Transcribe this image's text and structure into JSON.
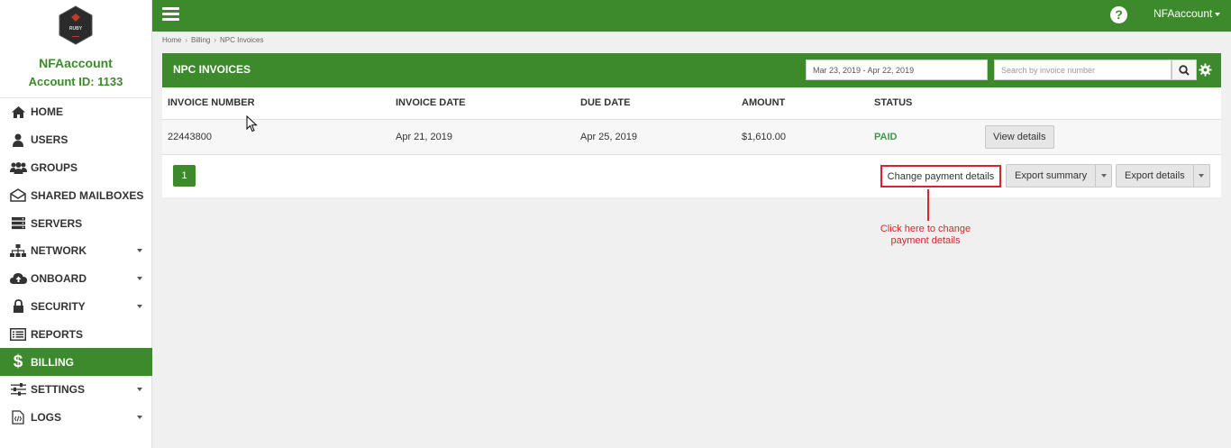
{
  "sidebar": {
    "logo_text": "RUBY",
    "account_name": "NFAaccount",
    "account_id": "Account ID: 1133",
    "items": [
      {
        "label": "HOME",
        "icon": "home-icon"
      },
      {
        "label": "USERS",
        "icon": "user-icon"
      },
      {
        "label": "GROUPS",
        "icon": "users-icon"
      },
      {
        "label": "SHARED MAILBOXES",
        "icon": "envelope-icon"
      },
      {
        "label": "SERVERS",
        "icon": "server-icon"
      },
      {
        "label": "NETWORK",
        "icon": "sitemap-icon"
      },
      {
        "label": "ONBOARD",
        "icon": "cloud-upload-icon"
      },
      {
        "label": "SECURITY",
        "icon": "lock-icon"
      },
      {
        "label": "REPORTS",
        "icon": "list-icon"
      },
      {
        "label": "BILLING",
        "icon": "dollar-icon"
      },
      {
        "label": "SETTINGS",
        "icon": "sliders-icon"
      },
      {
        "label": "LOGS",
        "icon": "code-file-icon"
      }
    ]
  },
  "topbar": {
    "help": "?",
    "user": "NFAaccount"
  },
  "breadcrumb": [
    "Home",
    "Billing",
    "NPC Invoices"
  ],
  "panel": {
    "title": "NPC INVOICES",
    "date_range": "Mar 23, 2019 - Apr 22, 2019",
    "search_placeholder": "Search by invoice number"
  },
  "table": {
    "headers": [
      "INVOICE NUMBER",
      "INVOICE DATE",
      "DUE DATE",
      "AMOUNT",
      "STATUS"
    ],
    "rows": [
      {
        "invoice_number": "22443800",
        "invoice_date": "Apr 21, 2019",
        "due_date": "Apr 25, 2019",
        "amount": "$1,610.00",
        "status": "PAID",
        "action": "View details"
      }
    ]
  },
  "footer": {
    "page": "1",
    "change_payment": "Change payment details",
    "export_summary": "Export summary",
    "export_details": "Export details"
  },
  "annotation": {
    "line1": "Click here to change",
    "line2": "payment details"
  },
  "colors": {
    "brand_green": "#3d8a2c",
    "paid_green": "#3d9a48",
    "annotation_red": "#d9232d"
  }
}
